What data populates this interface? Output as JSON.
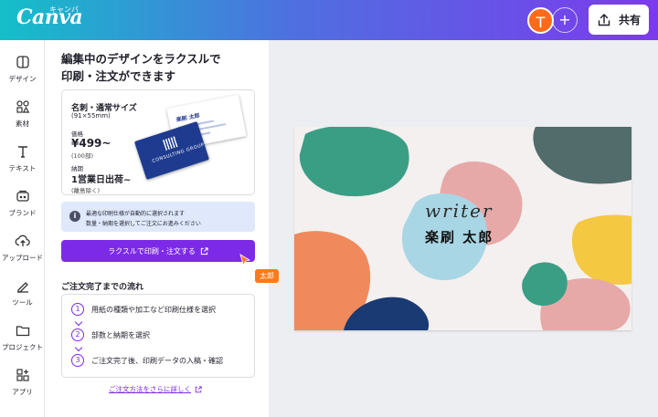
{
  "app": {
    "logo": "Canva",
    "logo_kana": "キャンバ",
    "avatar_initial": "T",
    "add_symbol": "+",
    "share_label": "共有"
  },
  "rail": {
    "items": [
      {
        "label": "デザイン",
        "icon": "design-icon"
      },
      {
        "label": "素材",
        "icon": "elements-icon"
      },
      {
        "label": "テキスト",
        "icon": "text-icon"
      },
      {
        "label": "ブランド",
        "icon": "brand-icon"
      },
      {
        "label": "アップロード",
        "icon": "upload-icon"
      },
      {
        "label": "ツール",
        "icon": "tools-icon"
      },
      {
        "label": "プロジェクト",
        "icon": "projects-icon"
      },
      {
        "label": "アプリ",
        "icon": "apps-icon"
      }
    ]
  },
  "panel": {
    "title_line1": "編集中のデザインをラクスルで",
    "title_line2": "印刷・注文ができます",
    "product": {
      "size_name": "名刺・通常サイズ",
      "dimensions": "(91×55mm)",
      "price_label": "価格",
      "price": "¥499~",
      "tax_note": "(100部)",
      "delivery_label": "納期",
      "delivery": "1営業日出荷~",
      "delivery_note": "(離島除く)",
      "preview_name": "楽刷 太郎",
      "preview_brand": "CONSULTING GROUP"
    },
    "notice": {
      "line1": "最適な印刷仕様が自動的に選択されます",
      "line2": "数量・納期を選択してご注文にお進みください"
    },
    "cta_label": "ラクスルで印刷・注文する",
    "flow_title": "ご注文完了までの流れ",
    "steps": [
      {
        "num": "1",
        "text": "用紙の種類や加工など印刷仕様を選択"
      },
      {
        "num": "2",
        "text": "部数と納期を選択"
      },
      {
        "num": "3",
        "text": "ご注文完了後、印刷データの入稿・確認"
      }
    ],
    "more_link": "ご注文方法をさらに詳しく"
  },
  "collaborator": {
    "name": "太郎",
    "color": "#ff7a1a"
  },
  "design": {
    "writer_text": "writer",
    "name_text": "楽刷 太郎",
    "palette": [
      "#3a9e85",
      "#e6a9a8",
      "#526b6b",
      "#f08a5d",
      "#a9d6e5",
      "#1a3a73",
      "#f5c842"
    ]
  },
  "colors": {
    "accent": "#7d2ae8"
  }
}
